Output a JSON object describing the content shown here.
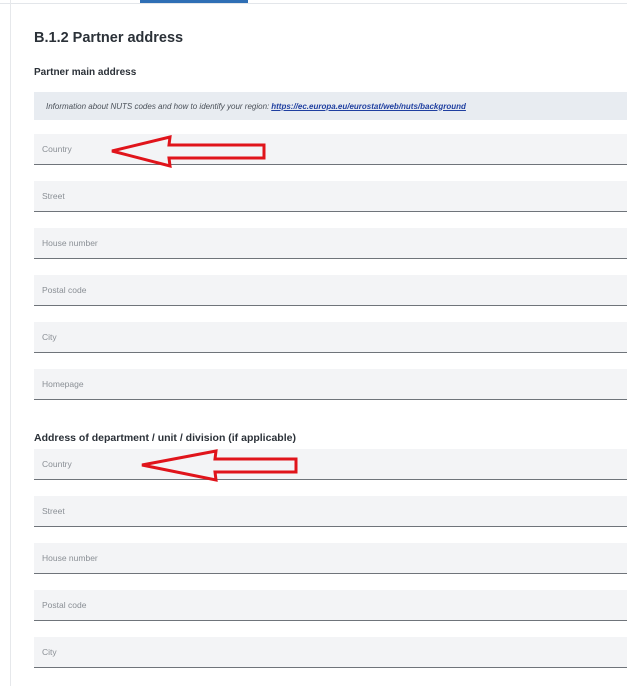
{
  "section_title": "B.1.2 Partner address",
  "main_address": {
    "heading": "Partner main address",
    "info_text": "Information about NUTS codes and how to identify your region:",
    "info_link": "https://ec.europa.eu/eurostat/web/nuts/background",
    "fields": [
      {
        "placeholder": "Country"
      },
      {
        "placeholder": "Street"
      },
      {
        "placeholder": "House number"
      },
      {
        "placeholder": "Postal code"
      },
      {
        "placeholder": "City"
      },
      {
        "placeholder": "Homepage"
      }
    ]
  },
  "department_address": {
    "heading": "Address of department / unit / division (if applicable)",
    "fields": [
      {
        "placeholder": "Country"
      },
      {
        "placeholder": "Street"
      },
      {
        "placeholder": "House number"
      },
      {
        "placeholder": "Postal code"
      },
      {
        "placeholder": "City"
      }
    ]
  },
  "annotation_color": "#e0141b",
  "annotations": [
    "red-arrow-icon",
    "red-arrow-icon"
  ]
}
